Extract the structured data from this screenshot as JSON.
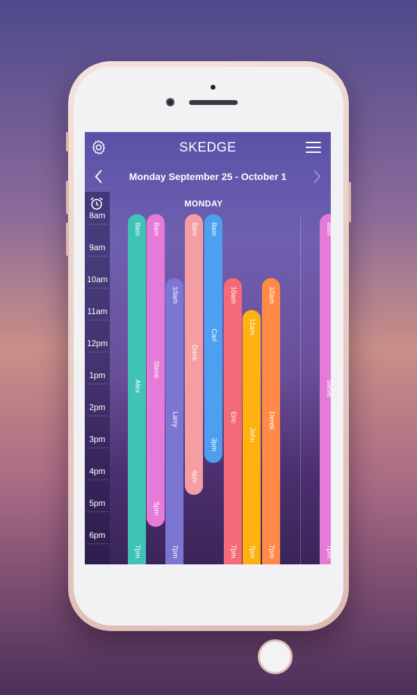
{
  "app": {
    "brand": "SKEDGE",
    "week_label": "Monday September 25 - October 1",
    "day_label": "MONDAY"
  },
  "times": [
    "8am",
    "9am",
    "10am",
    "11am",
    "12pm",
    "1pm",
    "2pm",
    "3pm",
    "4pm",
    "5pm",
    "6pm"
  ],
  "shifts": [
    {
      "name": "Alex",
      "start": "8am",
      "end": "7pm",
      "color": "#3fc3b6"
    },
    {
      "name": "Steve",
      "start": "8am",
      "end": "5pm",
      "color": "#e67ad8"
    },
    {
      "name": "Larry",
      "start": "10am",
      "end": "7pm",
      "color": "#7c76d2"
    },
    {
      "name": "Dave",
      "start": "8am",
      "end": "4pm",
      "color": "#f49ea3"
    },
    {
      "name": "Carl",
      "start": "8am",
      "end": "3pm",
      "color": "#4d9ff0"
    },
    {
      "name": "Eric",
      "start": "10am",
      "end": "7pm",
      "color": "#f56a78"
    },
    {
      "name": "John",
      "start": "11am",
      "end": "7pm",
      "color": "#ffb20f"
    },
    {
      "name": "Derek",
      "start": "10am",
      "end": "7pm",
      "color": "#ff8a47"
    },
    {
      "name": "Steve",
      "start": "8am",
      "end": "7pm",
      "color": "#e67ad8"
    }
  ],
  "icons": {
    "settings": "gear-icon",
    "menu": "hamburger-icon",
    "prev": "chevron-left-icon",
    "next": "chevron-right-icon",
    "alarm": "alarm-clock-icon"
  }
}
